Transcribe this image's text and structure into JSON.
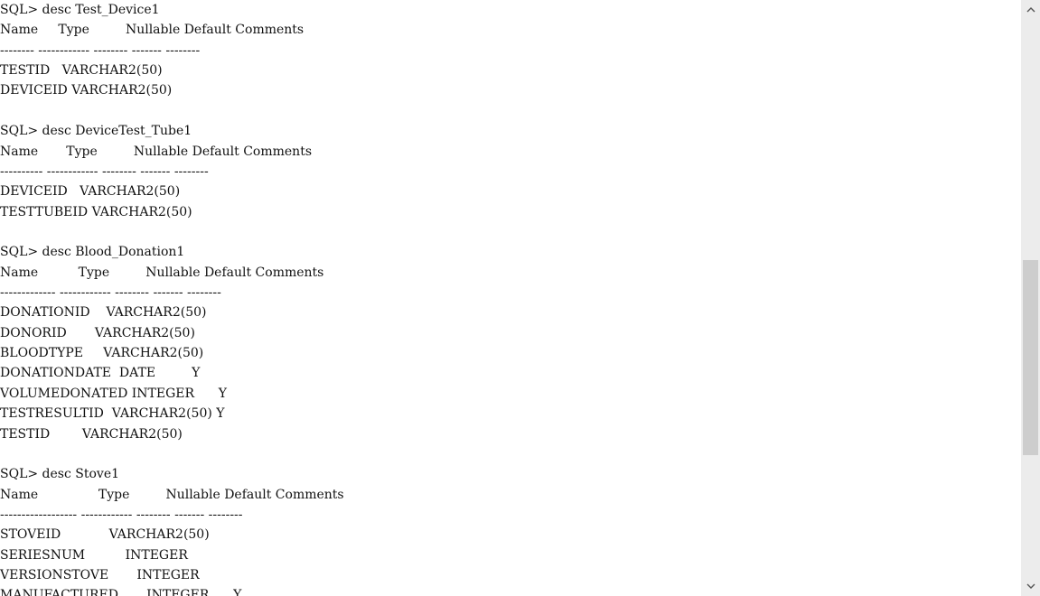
{
  "console": {
    "lines": [
      "SQL> desc Test_Device1",
      "Name     Type         Nullable Default Comments",
      "-------- ------------ -------- ------- --------",
      "TESTID   VARCHAR2(50)",
      "DEVICEID VARCHAR2(50)",
      "",
      "SQL> desc DeviceTest_Tube1",
      "Name       Type         Nullable Default Comments",
      "---------- ------------ -------- ------- --------",
      "DEVICEID   VARCHAR2(50)",
      "TESTTUBEID VARCHAR2(50)",
      "",
      "SQL> desc Blood_Donation1",
      "Name          Type         Nullable Default Comments",
      "------------- ------------ -------- ------- --------",
      "DONATIONID    VARCHAR2(50)",
      "DONORID       VARCHAR2(50)",
      "BLOODTYPE     VARCHAR2(50)",
      "DONATIONDATE  DATE         Y",
      "VOLUMEDONATED INTEGER      Y",
      "TESTRESULTID  VARCHAR2(50) Y",
      "TESTID        VARCHAR2(50)",
      "",
      "SQL> desc Stove1",
      "Name               Type         Nullable Default Comments",
      "------------------ ------------ -------- ------- --------",
      "STOVEID            VARCHAR2(50)",
      "SERIESNUM          INTEGER",
      "VERSIONSTOVE       INTEGER",
      "MANUFACTURED       INTEGER      Y"
    ]
  },
  "scrollbar": {
    "up_icon": "chevron-up-icon",
    "down_icon": "chevron-down-icon",
    "position_fraction": 0.44
  }
}
